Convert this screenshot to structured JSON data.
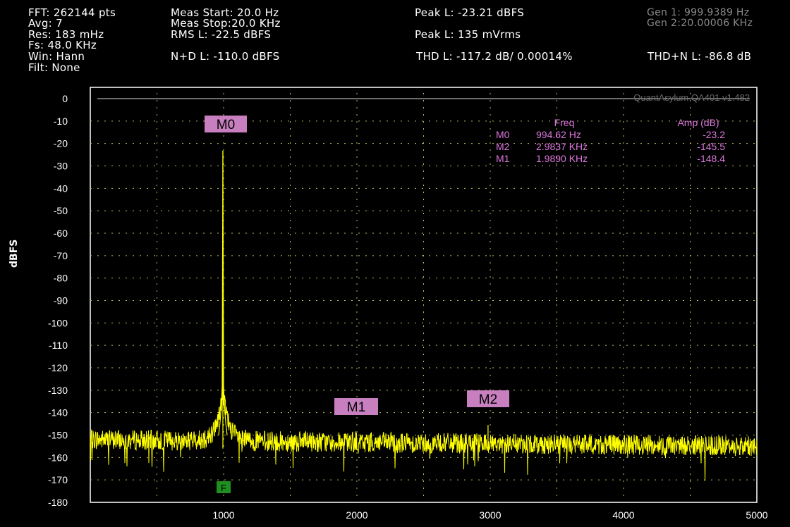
{
  "header": {
    "fft": "FFT: 262144 pts",
    "avg": "Avg: 7",
    "res": "Res: 183 mHz",
    "fs": "Fs: 48.0 KHz",
    "win": "Win: Hann",
    "filt": "Filt: None",
    "meas_start": "Meas Start: 20.0 Hz",
    "meas_stop": "Meas Stop:20.0 KHz",
    "rms": "RMS L: -22.5 dBFS",
    "nd": "N+D L: -110.0 dBFS",
    "peak_dbfs": "Peak L: -23.21 dBFS",
    "peak_vrms": "Peak L: 135 mVrms",
    "thd": "THD L: -117.2 dB/ 0.00014%",
    "gen1": "Gen 1: 999.9389 Hz",
    "gen2": "Gen 2:20.00006 KHz",
    "thdn": "THD+N L: -86.8 dB"
  },
  "colors": {
    "trace": "#ffff00",
    "marker_bg": "#c77fbf",
    "marker_text": "#dd77dd",
    "grid": "#bfbf60",
    "filter_marker": "#1f8f1f"
  },
  "chart_data": {
    "type": "line",
    "ylabel": "dBFS",
    "xlim": [
      0,
      5000
    ],
    "ylim": [
      -180,
      0
    ],
    "xticks": [
      1000,
      2000,
      3000,
      4000,
      5000
    ],
    "yticks": [
      0,
      -10,
      -20,
      -30,
      -40,
      -50,
      -60,
      -70,
      -80,
      -90,
      -100,
      -110,
      -120,
      -130,
      -140,
      -150,
      -160,
      -170,
      -180
    ],
    "grid": true,
    "watermark": "QuantAsylum QA401 v1.482",
    "noise_floor_db": -156,
    "series": [
      {
        "peaks": [
          {
            "freq": 994.62,
            "amp": -23.2
          },
          {
            "freq": 1989.0,
            "amp": -148.4
          },
          {
            "freq": 2983.7,
            "amp": -145.5
          },
          {
            "freq": 860,
            "amp": -148
          },
          {
            "freq": 1140,
            "amp": -148
          }
        ]
      }
    ],
    "markers": [
      {
        "label": "M0",
        "freq": 994.62,
        "amp": -23.2,
        "freq_text": "994.62 Hz",
        "amp_text": "-23.2"
      },
      {
        "label": "M2",
        "freq": 2983.7,
        "amp": -145.5,
        "freq_text": "2.9837 KHz",
        "amp_text": "-145.5"
      },
      {
        "label": "M1",
        "freq": 1989.0,
        "amp": -148.4,
        "freq_text": "1.9890 KHz",
        "amp_text": "-148.4"
      }
    ],
    "marker_table_headers": {
      "freq": "Freq",
      "amp": "Amp (dB)"
    },
    "filter_marker": {
      "label": "F",
      "freq": 1000
    }
  }
}
